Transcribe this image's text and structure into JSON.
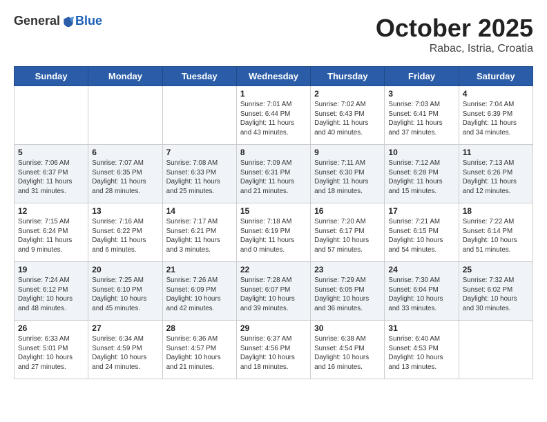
{
  "header": {
    "logo_general": "General",
    "logo_blue": "Blue",
    "month": "October 2025",
    "location": "Rabac, Istria, Croatia"
  },
  "weekdays": [
    "Sunday",
    "Monday",
    "Tuesday",
    "Wednesday",
    "Thursday",
    "Friday",
    "Saturday"
  ],
  "weeks": [
    [
      {
        "day": "",
        "info": ""
      },
      {
        "day": "",
        "info": ""
      },
      {
        "day": "",
        "info": ""
      },
      {
        "day": "1",
        "info": "Sunrise: 7:01 AM\nSunset: 6:44 PM\nDaylight: 11 hours\nand 43 minutes."
      },
      {
        "day": "2",
        "info": "Sunrise: 7:02 AM\nSunset: 6:43 PM\nDaylight: 11 hours\nand 40 minutes."
      },
      {
        "day": "3",
        "info": "Sunrise: 7:03 AM\nSunset: 6:41 PM\nDaylight: 11 hours\nand 37 minutes."
      },
      {
        "day": "4",
        "info": "Sunrise: 7:04 AM\nSunset: 6:39 PM\nDaylight: 11 hours\nand 34 minutes."
      }
    ],
    [
      {
        "day": "5",
        "info": "Sunrise: 7:06 AM\nSunset: 6:37 PM\nDaylight: 11 hours\nand 31 minutes."
      },
      {
        "day": "6",
        "info": "Sunrise: 7:07 AM\nSunset: 6:35 PM\nDaylight: 11 hours\nand 28 minutes."
      },
      {
        "day": "7",
        "info": "Sunrise: 7:08 AM\nSunset: 6:33 PM\nDaylight: 11 hours\nand 25 minutes."
      },
      {
        "day": "8",
        "info": "Sunrise: 7:09 AM\nSunset: 6:31 PM\nDaylight: 11 hours\nand 21 minutes."
      },
      {
        "day": "9",
        "info": "Sunrise: 7:11 AM\nSunset: 6:30 PM\nDaylight: 11 hours\nand 18 minutes."
      },
      {
        "day": "10",
        "info": "Sunrise: 7:12 AM\nSunset: 6:28 PM\nDaylight: 11 hours\nand 15 minutes."
      },
      {
        "day": "11",
        "info": "Sunrise: 7:13 AM\nSunset: 6:26 PM\nDaylight: 11 hours\nand 12 minutes."
      }
    ],
    [
      {
        "day": "12",
        "info": "Sunrise: 7:15 AM\nSunset: 6:24 PM\nDaylight: 11 hours\nand 9 minutes."
      },
      {
        "day": "13",
        "info": "Sunrise: 7:16 AM\nSunset: 6:22 PM\nDaylight: 11 hours\nand 6 minutes."
      },
      {
        "day": "14",
        "info": "Sunrise: 7:17 AM\nSunset: 6:21 PM\nDaylight: 11 hours\nand 3 minutes."
      },
      {
        "day": "15",
        "info": "Sunrise: 7:18 AM\nSunset: 6:19 PM\nDaylight: 11 hours\nand 0 minutes."
      },
      {
        "day": "16",
        "info": "Sunrise: 7:20 AM\nSunset: 6:17 PM\nDaylight: 10 hours\nand 57 minutes."
      },
      {
        "day": "17",
        "info": "Sunrise: 7:21 AM\nSunset: 6:15 PM\nDaylight: 10 hours\nand 54 minutes."
      },
      {
        "day": "18",
        "info": "Sunrise: 7:22 AM\nSunset: 6:14 PM\nDaylight: 10 hours\nand 51 minutes."
      }
    ],
    [
      {
        "day": "19",
        "info": "Sunrise: 7:24 AM\nSunset: 6:12 PM\nDaylight: 10 hours\nand 48 minutes."
      },
      {
        "day": "20",
        "info": "Sunrise: 7:25 AM\nSunset: 6:10 PM\nDaylight: 10 hours\nand 45 minutes."
      },
      {
        "day": "21",
        "info": "Sunrise: 7:26 AM\nSunset: 6:09 PM\nDaylight: 10 hours\nand 42 minutes."
      },
      {
        "day": "22",
        "info": "Sunrise: 7:28 AM\nSunset: 6:07 PM\nDaylight: 10 hours\nand 39 minutes."
      },
      {
        "day": "23",
        "info": "Sunrise: 7:29 AM\nSunset: 6:05 PM\nDaylight: 10 hours\nand 36 minutes."
      },
      {
        "day": "24",
        "info": "Sunrise: 7:30 AM\nSunset: 6:04 PM\nDaylight: 10 hours\nand 33 minutes."
      },
      {
        "day": "25",
        "info": "Sunrise: 7:32 AM\nSunset: 6:02 PM\nDaylight: 10 hours\nand 30 minutes."
      }
    ],
    [
      {
        "day": "26",
        "info": "Sunrise: 6:33 AM\nSunset: 5:01 PM\nDaylight: 10 hours\nand 27 minutes."
      },
      {
        "day": "27",
        "info": "Sunrise: 6:34 AM\nSunset: 4:59 PM\nDaylight: 10 hours\nand 24 minutes."
      },
      {
        "day": "28",
        "info": "Sunrise: 6:36 AM\nSunset: 4:57 PM\nDaylight: 10 hours\nand 21 minutes."
      },
      {
        "day": "29",
        "info": "Sunrise: 6:37 AM\nSunset: 4:56 PM\nDaylight: 10 hours\nand 18 minutes."
      },
      {
        "day": "30",
        "info": "Sunrise: 6:38 AM\nSunset: 4:54 PM\nDaylight: 10 hours\nand 16 minutes."
      },
      {
        "day": "31",
        "info": "Sunrise: 6:40 AM\nSunset: 4:53 PM\nDaylight: 10 hours\nand 13 minutes."
      },
      {
        "day": "",
        "info": ""
      }
    ]
  ]
}
